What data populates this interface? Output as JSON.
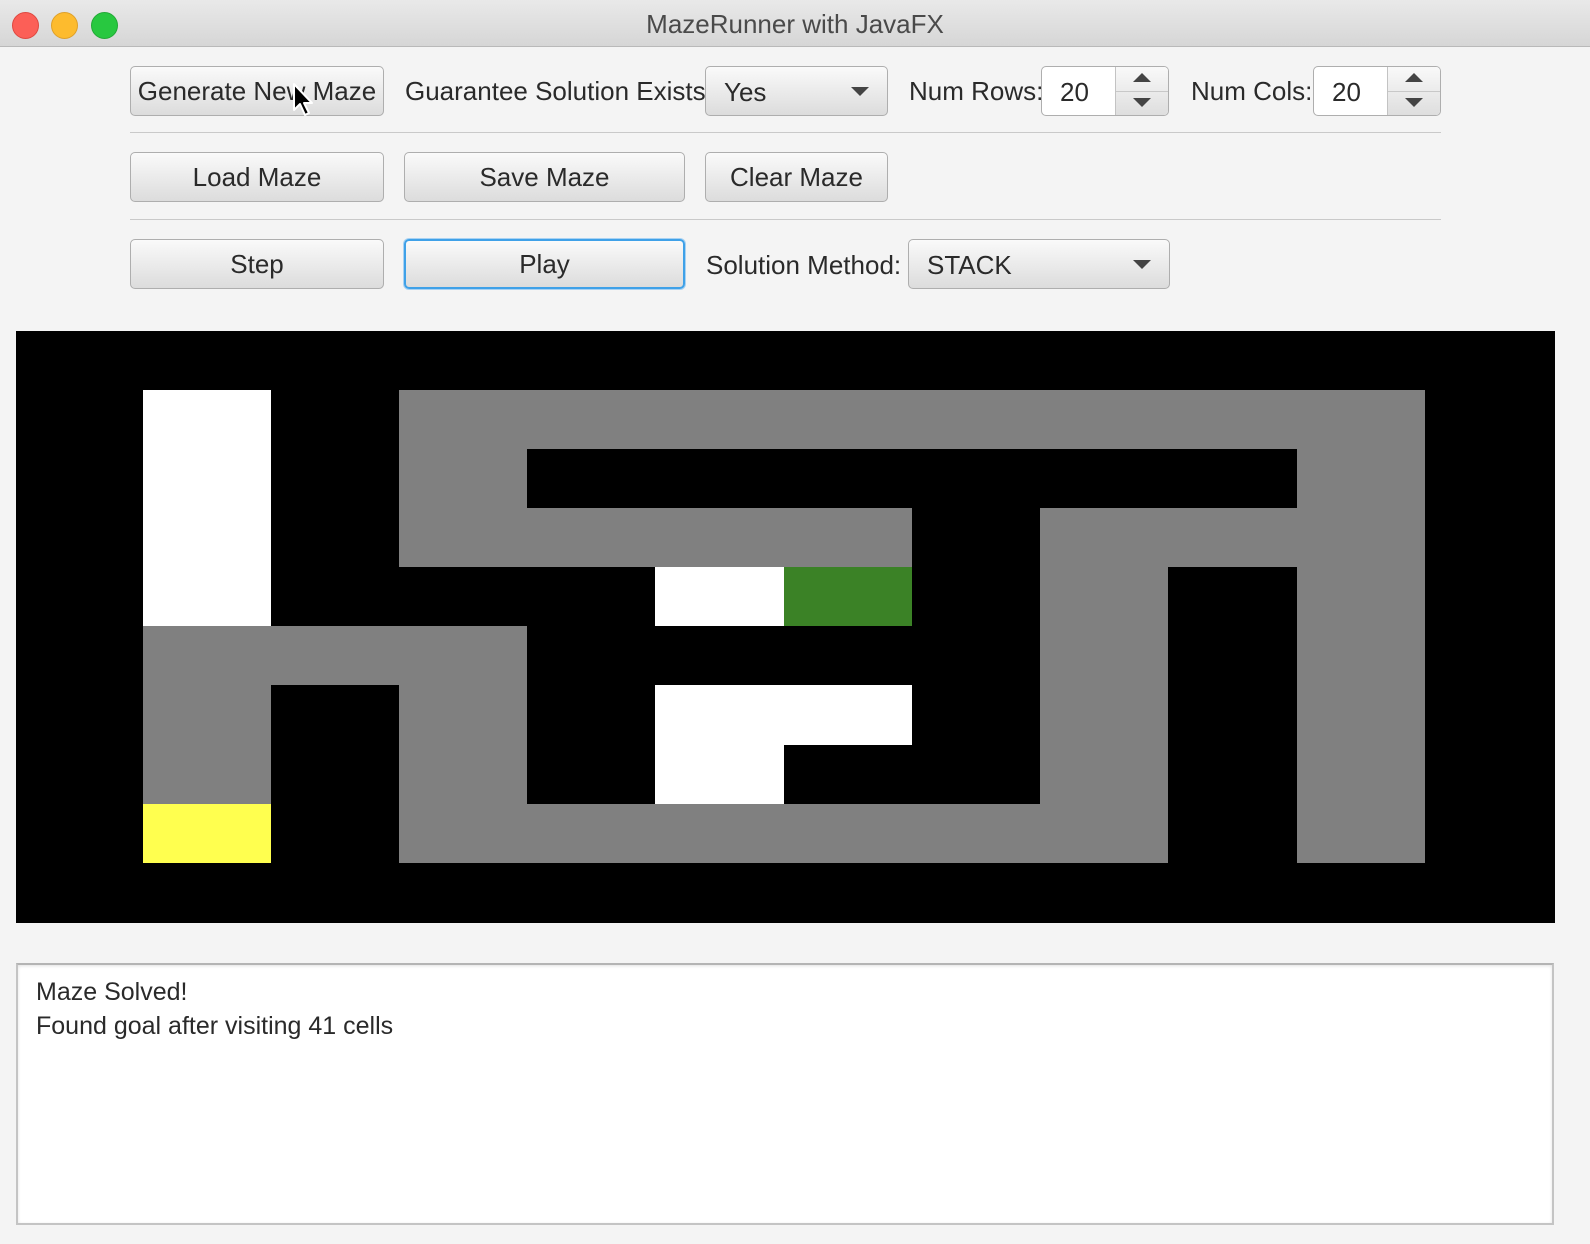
{
  "window": {
    "title": "MazeRunner with JavaFX"
  },
  "row1": {
    "generate_label": "Generate New Maze",
    "guarantee_label": "Guarantee Solution Exists:",
    "guarantee_value": "Yes",
    "rows_label": "Num Rows:",
    "rows_value": "20",
    "cols_label": "Num Cols:",
    "cols_value": "20"
  },
  "row2": {
    "load_label": "Load Maze",
    "save_label": "Save Maze",
    "clear_label": "Clear Maze"
  },
  "row3": {
    "step_label": "Step",
    "play_label": "Play",
    "method_label": "Solution Method:",
    "method_value": "STACK"
  },
  "maze": {
    "colors": {
      "wall": "#000000",
      "explored": "#808080",
      "open": "#ffffff",
      "start": "#3b8226",
      "goal": "#ffff4f"
    }
  },
  "log": {
    "lines": [
      "Maze Solved!",
      "Found goal after visiting 41 cells"
    ]
  }
}
